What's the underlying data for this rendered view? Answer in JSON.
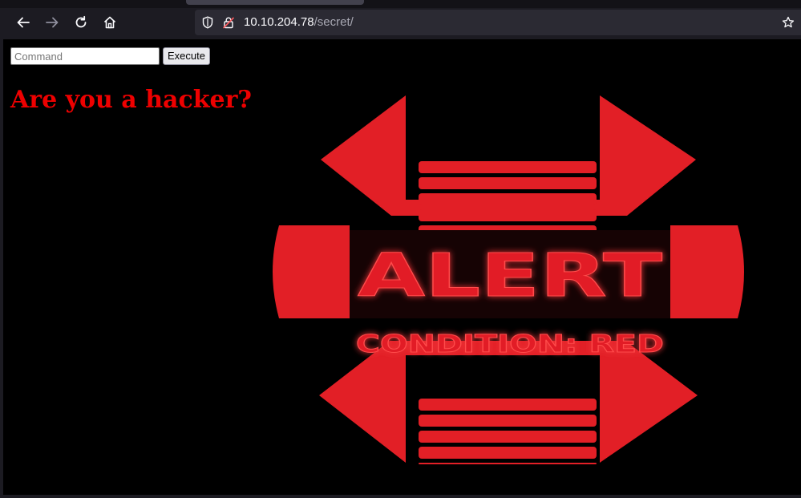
{
  "browser": {
    "url_host": "10.10.204.78",
    "url_path": "/secret/",
    "icons": [
      "back-arrow-icon",
      "forward-arrow-icon",
      "reload-icon",
      "home-icon",
      "shield-icon",
      "insecure-lock-icon",
      "bookmark-star-icon"
    ]
  },
  "page": {
    "command_placeholder": "Command",
    "command_value": "",
    "execute_label": "Execute",
    "headline": "Are you a hacker?",
    "headline_color": "#ee0000",
    "alert_image": {
      "line1": "ALERT",
      "line2": "CONDITION: RED",
      "color": "#e21f26"
    }
  }
}
